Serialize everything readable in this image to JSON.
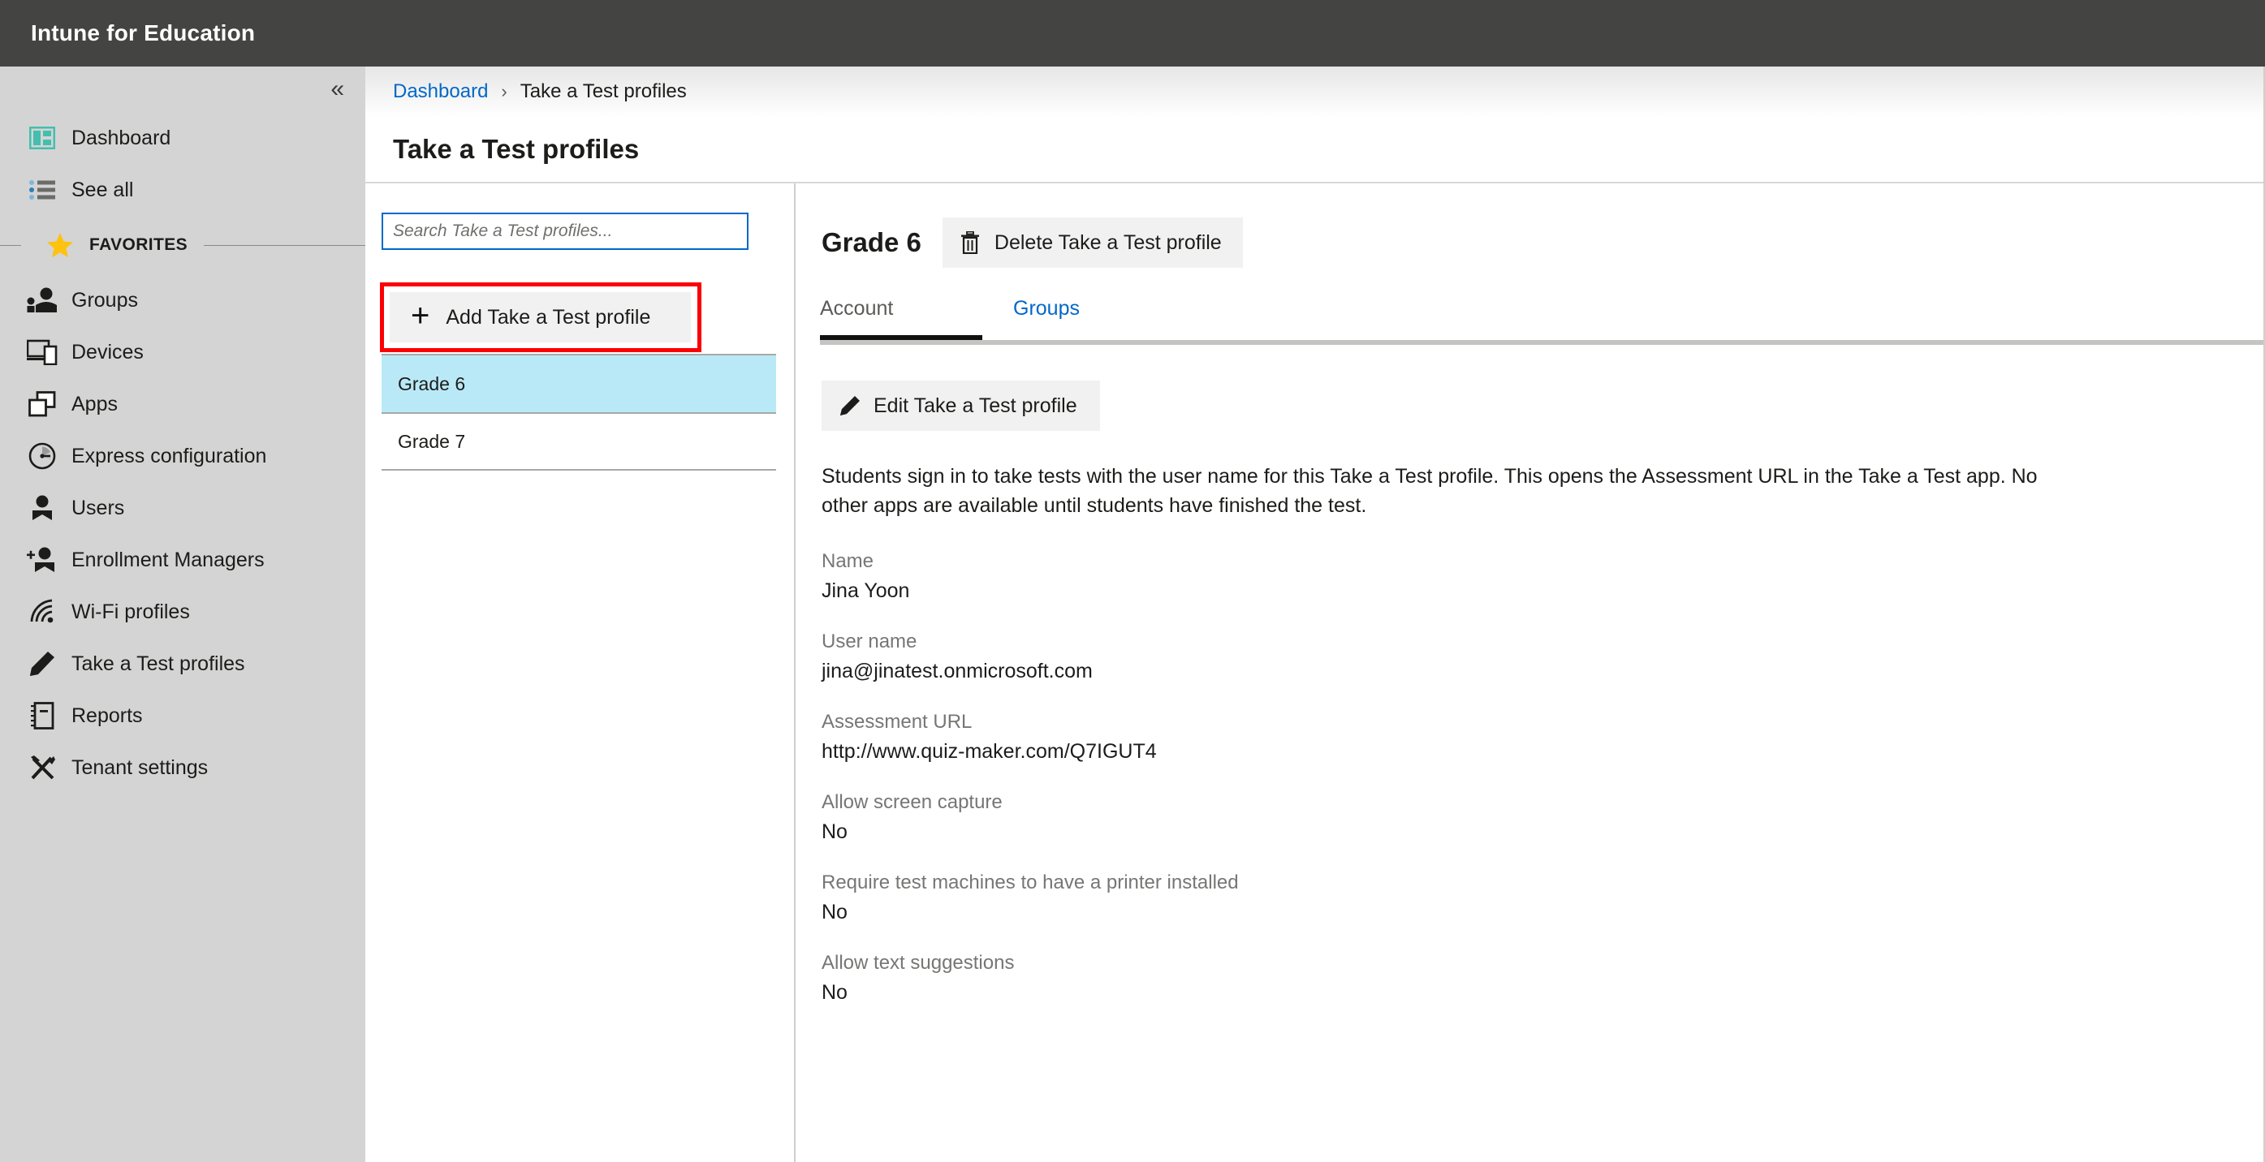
{
  "app": {
    "title": "Intune for Education",
    "brand_bar_color": "#444442",
    "accent_link_color": "#0068c8",
    "highlight_color": "#fb0004",
    "selected_row_color": "#b9e9f7"
  },
  "sidebar": {
    "collapse_icon": "chevron-double-left-icon",
    "top_items": [
      {
        "label": "Dashboard",
        "icon": "dashboard-icon"
      },
      {
        "label": "See all",
        "icon": "list-icon"
      }
    ],
    "favorites_label": "FAVORITES",
    "favorites_icon": "star-icon",
    "items": [
      {
        "label": "Groups",
        "icon": "groups-icon"
      },
      {
        "label": "Devices",
        "icon": "devices-icon"
      },
      {
        "label": "Apps",
        "icon": "apps-icon"
      },
      {
        "label": "Express configuration",
        "icon": "gauge-icon"
      },
      {
        "label": "Users",
        "icon": "user-icon"
      },
      {
        "label": "Enrollment Managers",
        "icon": "add-user-icon"
      },
      {
        "label": "Wi-Fi profiles",
        "icon": "wifi-icon"
      },
      {
        "label": "Take a Test profiles",
        "icon": "pencil-icon"
      },
      {
        "label": "Reports",
        "icon": "report-icon"
      },
      {
        "label": "Tenant settings",
        "icon": "tools-icon"
      }
    ]
  },
  "breadcrumb": {
    "root": "Dashboard",
    "separator": "›",
    "current": "Take a Test profiles"
  },
  "page": {
    "title": "Take a Test profiles"
  },
  "list_pane": {
    "search": {
      "value": "",
      "placeholder": "Search Take a Test profiles..."
    },
    "add_button": {
      "label": "Add Take a Test profile",
      "icon": "plus-icon",
      "highlighted": true
    },
    "profiles": [
      {
        "name": "Grade 6",
        "selected": true
      },
      {
        "name": "Grade 7",
        "selected": false
      }
    ]
  },
  "detail": {
    "title": "Grade 6",
    "delete_button": {
      "label": "Delete Take a Test profile",
      "icon": "trash-icon"
    },
    "tabs": [
      {
        "label": "Account",
        "active": true
      },
      {
        "label": "Groups",
        "active": false
      }
    ],
    "edit_button": {
      "label": "Edit Take a Test profile",
      "icon": "pencil-icon"
    },
    "description": "Students sign in to take tests with the user name for this Take a Test profile. This opens the Assessment URL in the Take a Test app. No other apps are available until students have finished the test.",
    "fields": [
      {
        "label": "Name",
        "value": "Jina Yoon"
      },
      {
        "label": "User name",
        "value": "jina@jinatest.onmicrosoft.com"
      },
      {
        "label": "Assessment URL",
        "value": "http://www.quiz-maker.com/Q7IGUT4"
      },
      {
        "label": "Allow screen capture",
        "value": "No"
      },
      {
        "label": "Require test machines to have a printer installed",
        "value": "No"
      },
      {
        "label": "Allow text suggestions",
        "value": "No"
      }
    ]
  }
}
